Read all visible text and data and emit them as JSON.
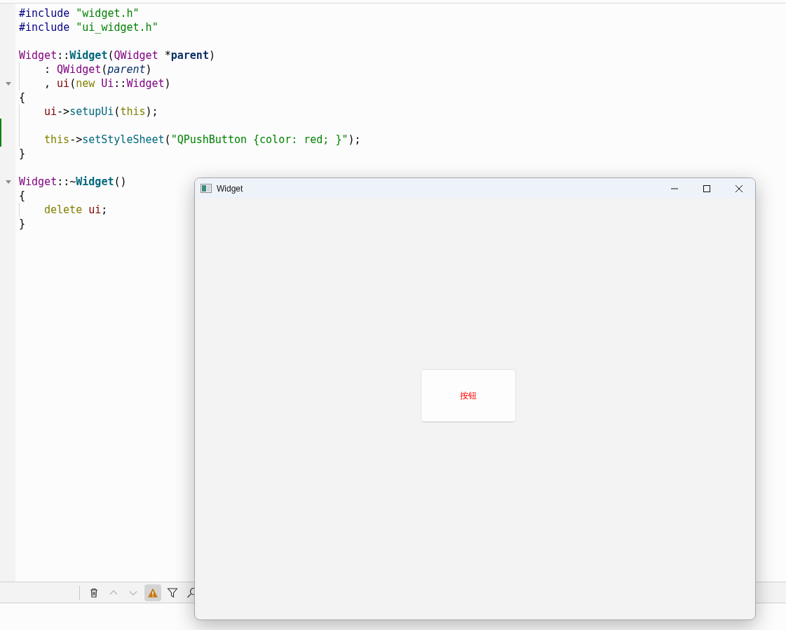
{
  "editor": {
    "lines": [
      {
        "tokens": [
          {
            "text": "#include",
            "kind": "pre"
          },
          {
            "text": " \"widget.h\"",
            "kind": "str"
          }
        ],
        "foldable": false,
        "modified": false
      },
      {
        "tokens": [
          {
            "text": "#include",
            "kind": "pre"
          },
          {
            "text": " \"ui_widget.h\"",
            "kind": "str"
          }
        ],
        "foldable": false,
        "modified": false
      },
      {
        "foldable": false,
        "modified": false
      },
      {
        "tokens": [
          {
            "text": "Widget",
            "kind": "type"
          },
          {
            "text": "::",
            "kind": "plain"
          },
          {
            "text": "Widget",
            "kind": "func"
          },
          {
            "text": "(",
            "kind": "plain"
          },
          {
            "text": "QWidget",
            "kind": "type"
          },
          {
            "text": " *",
            "kind": "plain"
          },
          {
            "text": "parent",
            "kind": "param"
          },
          {
            "text": ")",
            "kind": "plain"
          }
        ],
        "foldable": false,
        "modified": false
      },
      {
        "indent": true,
        "tokens": [
          {
            "text": ": ",
            "kind": "plain"
          },
          {
            "text": "QWidget",
            "kind": "type"
          },
          {
            "text": "(",
            "kind": "plain"
          },
          {
            "text": "parent",
            "kind": "italic"
          },
          {
            "text": ")",
            "kind": "plain"
          }
        ],
        "foldable": false,
        "modified": false
      },
      {
        "indent": true,
        "tokens": [
          {
            "text": ", ",
            "kind": "plain"
          },
          {
            "text": "ui",
            "kind": "member"
          },
          {
            "text": "(",
            "kind": "plain"
          },
          {
            "text": "new",
            "kind": "kw"
          },
          {
            "text": " Ui",
            "kind": "type"
          },
          {
            "text": "::",
            "kind": "plain"
          },
          {
            "text": "Widget",
            "kind": "type"
          },
          {
            "text": ")",
            "kind": "plain"
          }
        ],
        "foldable": true,
        "modified": false
      },
      {
        "tokens": [
          {
            "text": "{",
            "kind": "plain"
          }
        ],
        "foldable": false,
        "modified": false
      },
      {
        "indent": true,
        "tokens": [
          {
            "text": "ui",
            "kind": "member"
          },
          {
            "text": "->",
            "kind": "plain"
          },
          {
            "text": "setupUi",
            "kind": "method"
          },
          {
            "text": "(",
            "kind": "plain"
          },
          {
            "text": "this",
            "kind": "kw"
          },
          {
            "text": ");",
            "kind": "plain"
          }
        ],
        "foldable": false,
        "modified": false
      },
      {
        "indent": true,
        "foldable": false,
        "modified": true
      },
      {
        "indent": true,
        "tokens": [
          {
            "text": "this",
            "kind": "kw"
          },
          {
            "text": "->",
            "kind": "plain"
          },
          {
            "text": "setStyleSheet",
            "kind": "method"
          },
          {
            "text": "(",
            "kind": "plain"
          },
          {
            "text": "\"QPushButton {color: red; }\"",
            "kind": "str"
          },
          {
            "text": ");",
            "kind": "plain"
          }
        ],
        "foldable": false,
        "modified": true
      },
      {
        "tokens": [
          {
            "text": "}",
            "kind": "plain"
          }
        ],
        "foldable": false,
        "modified": false
      },
      {
        "foldable": false,
        "modified": false
      },
      {
        "tokens": [
          {
            "text": "Widget",
            "kind": "type"
          },
          {
            "text": "::~",
            "kind": "plain"
          },
          {
            "text": "Widget",
            "kind": "func"
          },
          {
            "text": "()",
            "kind": "plain"
          }
        ],
        "foldable": true,
        "modified": false
      },
      {
        "tokens": [
          {
            "text": "{",
            "kind": "plain"
          }
        ],
        "foldable": false,
        "modified": false
      },
      {
        "indent": true,
        "tokens": [
          {
            "text": "delete",
            "kind": "kw"
          },
          {
            "text": " ui",
            "kind": "member"
          },
          {
            "text": ";",
            "kind": "plain"
          }
        ],
        "foldable": false,
        "modified": false
      },
      {
        "tokens": [
          {
            "text": "}",
            "kind": "plain"
          }
        ],
        "foldable": false,
        "modified": false
      }
    ]
  },
  "output_toolbar": {
    "buttons": [
      {
        "kind": "trash",
        "disabled": false,
        "on": false
      },
      {
        "kind": "up",
        "disabled": true,
        "on": false
      },
      {
        "kind": "down",
        "disabled": true,
        "on": false
      },
      {
        "kind": "warning",
        "disabled": false,
        "on": true
      },
      {
        "kind": "filter",
        "disabled": false,
        "on": false
      },
      {
        "kind": "search",
        "disabled": false,
        "on": false
      }
    ]
  },
  "app_window": {
    "title": "Widget",
    "button": {
      "label": "按钮"
    }
  }
}
